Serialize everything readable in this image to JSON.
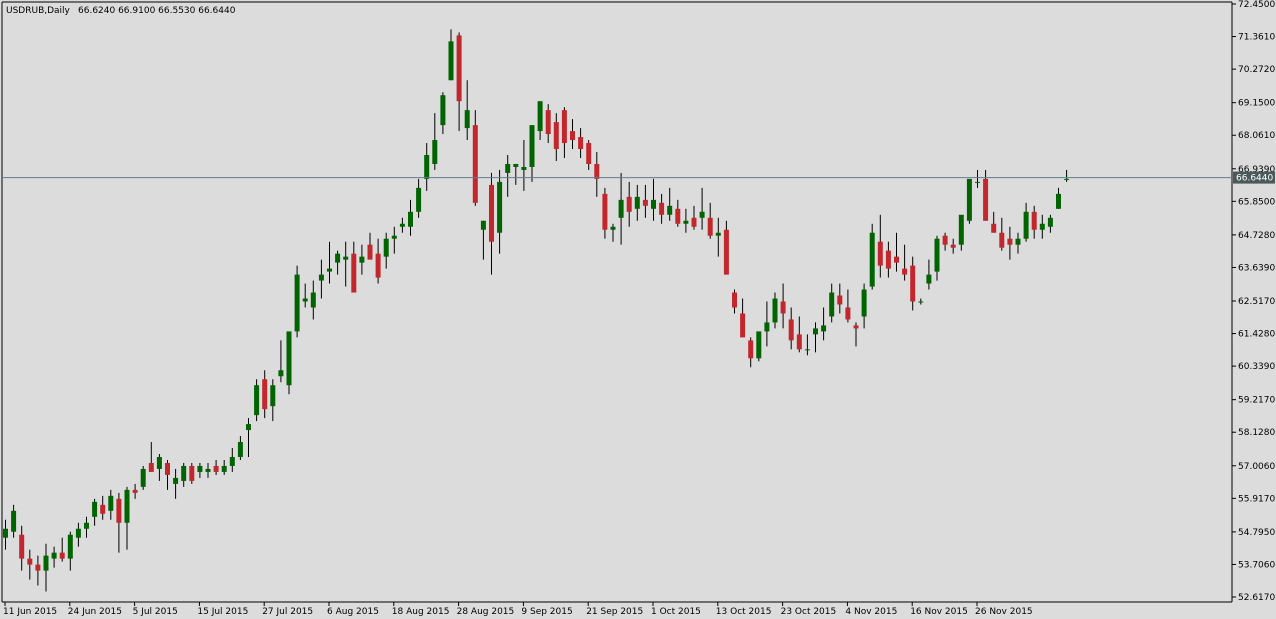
{
  "header": {
    "symbol_label": "USDRUB,Daily",
    "ohlc_label": "66.6240 66.9100 66.5530 66.6440"
  },
  "colors": {
    "background": "#dcdcdc",
    "bull": "#006400",
    "bear": "#c1272d",
    "wick": "#000000",
    "axis": "#000000",
    "price_line": "#5f7f8f",
    "price_label_bg": "#4a5a5a",
    "price_label_text": "#ffffff"
  },
  "chart_data": {
    "type": "candlestick",
    "title": "USDRUB,Daily",
    "grid": false,
    "ylim": [
      52.617,
      72.45
    ],
    "current_price": 66.644,
    "y_ticks": [
      "72.4500",
      "71.3610",
      "70.2720",
      "69.1500",
      "68.0610",
      "66.9390",
      "65.8500",
      "64.7280",
      "63.6390",
      "62.5170",
      "61.4280",
      "60.3390",
      "59.2170",
      "58.1280",
      "57.0060",
      "55.9170",
      "54.7950",
      "53.7060",
      "52.6170"
    ],
    "x_ticks": [
      "11 Jun 2015",
      "24 Jun 2015",
      "5 Jul 2015",
      "15 Jul 2015",
      "27 Jul 2015",
      "6 Aug 2015",
      "18 Aug 2015",
      "28 Aug 2015",
      "9 Sep 2015",
      "21 Sep 2015",
      "1 Oct 2015",
      "13 Oct 2015",
      "23 Oct 2015",
      "4 Nov 2015",
      "16 Nov 2015",
      "26 Nov 2015"
    ],
    "x_tick_index": [
      0,
      8,
      16,
      24,
      32,
      40,
      48,
      56,
      64,
      72,
      80,
      88,
      96,
      104,
      112,
      120
    ],
    "candles": [
      [
        54.6,
        55.2,
        54.2,
        54.9
      ],
      [
        54.8,
        55.7,
        54.6,
        55.5
      ],
      [
        54.7,
        55.0,
        53.5,
        53.9
      ],
      [
        53.9,
        54.2,
        53.2,
        53.7
      ],
      [
        53.7,
        54.0,
        53.0,
        53.5
      ],
      [
        53.5,
        54.4,
        52.8,
        54.0
      ],
      [
        53.9,
        54.3,
        53.6,
        54.1
      ],
      [
        54.1,
        54.6,
        53.8,
        53.9
      ],
      [
        53.9,
        54.8,
        53.5,
        54.7
      ],
      [
        54.6,
        55.1,
        54.3,
        54.9
      ],
      [
        54.9,
        55.3,
        54.6,
        55.1
      ],
      [
        55.3,
        55.9,
        55.0,
        55.8
      ],
      [
        55.7,
        56.0,
        55.2,
        55.4
      ],
      [
        55.5,
        56.2,
        55.2,
        56.0
      ],
      [
        55.9,
        56.1,
        54.1,
        55.1
      ],
      [
        55.1,
        56.3,
        54.2,
        56.2
      ],
      [
        56.2,
        56.4,
        55.9,
        56.1
      ],
      [
        56.3,
        57.0,
        56.2,
        56.9
      ],
      [
        57.1,
        57.8,
        56.9,
        56.8
      ],
      [
        56.9,
        57.4,
        56.5,
        57.3
      ],
      [
        57.1,
        57.2,
        56.2,
        56.7
      ],
      [
        56.4,
        56.9,
        55.9,
        56.6
      ],
      [
        56.5,
        57.1,
        56.3,
        57.0
      ],
      [
        57.0,
        57.1,
        56.4,
        56.5
      ],
      [
        56.8,
        57.1,
        56.6,
        57.0
      ],
      [
        56.8,
        57.1,
        56.6,
        56.9
      ],
      [
        57.0,
        57.2,
        56.7,
        56.8
      ],
      [
        56.8,
        57.2,
        56.7,
        57.0
      ],
      [
        57.0,
        57.6,
        56.8,
        57.3
      ],
      [
        57.3,
        58.0,
        57.2,
        57.8
      ],
      [
        58.2,
        58.6,
        57.3,
        58.4
      ],
      [
        58.7,
        59.9,
        58.5,
        59.7
      ],
      [
        59.9,
        60.2,
        58.6,
        58.9
      ],
      [
        59.0,
        59.9,
        58.5,
        59.7
      ],
      [
        60.0,
        61.2,
        59.8,
        60.2
      ],
      [
        59.7,
        60.9,
        59.4,
        61.5
      ],
      [
        61.5,
        63.7,
        61.3,
        63.4
      ],
      [
        62.5,
        63.1,
        62.3,
        62.6
      ],
      [
        62.3,
        63.2,
        61.9,
        62.8
      ],
      [
        63.2,
        63.9,
        62.6,
        63.4
      ],
      [
        63.5,
        64.5,
        63.1,
        63.6
      ],
      [
        63.8,
        64.2,
        63.4,
        64.1
      ],
      [
        63.9,
        64.5,
        63.0,
        64.0
      ],
      [
        64.1,
        64.5,
        62.9,
        62.8
      ],
      [
        63.8,
        64.4,
        63.4,
        64.0
      ],
      [
        64.4,
        64.8,
        64.0,
        63.9
      ],
      [
        64.1,
        64.6,
        63.1,
        63.3
      ],
      [
        64.0,
        64.8,
        63.6,
        64.6
      ],
      [
        64.6,
        65.0,
        64.1,
        64.7
      ],
      [
        65.0,
        65.3,
        64.8,
        65.1
      ],
      [
        65.0,
        65.9,
        64.7,
        65.5
      ],
      [
        65.5,
        66.6,
        65.3,
        66.3
      ],
      [
        66.6,
        67.8,
        66.2,
        67.4
      ],
      [
        67.1,
        68.8,
        66.9,
        67.9
      ],
      [
        68.4,
        69.5,
        68.1,
        69.4
      ],
      [
        69.9,
        71.6,
        69.9,
        71.2
      ],
      [
        71.4,
        71.5,
        68.2,
        69.2
      ],
      [
        68.3,
        69.9,
        67.9,
        68.9
      ],
      [
        68.4,
        68.9,
        65.7,
        65.8
      ],
      [
        64.9,
        65.2,
        63.9,
        65.2
      ],
      [
        66.4,
        66.8,
        63.4,
        64.5
      ],
      [
        64.8,
        66.9,
        64.1,
        66.5
      ],
      [
        66.8,
        67.4,
        66.0,
        67.1
      ],
      [
        67.0,
        67.1,
        66.4,
        67.1
      ],
      [
        66.9,
        67.9,
        66.2,
        67.0
      ],
      [
        67.0,
        68.0,
        66.5,
        68.4
      ],
      [
        68.2,
        68.9,
        67.9,
        69.2
      ],
      [
        68.9,
        69.1,
        67.8,
        68.1
      ],
      [
        68.5,
        68.8,
        67.2,
        67.6
      ],
      [
        68.9,
        69.0,
        67.3,
        67.8
      ],
      [
        68.2,
        68.6,
        67.6,
        67.9
      ],
      [
        68.0,
        68.3,
        67.3,
        67.6
      ],
      [
        67.8,
        67.9,
        66.9,
        67.1
      ],
      [
        67.1,
        67.5,
        66.0,
        66.6
      ],
      [
        66.1,
        66.3,
        64.6,
        64.9
      ],
      [
        64.9,
        65.1,
        64.5,
        65.0
      ],
      [
        65.3,
        66.8,
        64.4,
        65.9
      ],
      [
        66.0,
        66.5,
        65.0,
        65.5
      ],
      [
        65.6,
        66.4,
        65.2,
        66.0
      ],
      [
        65.9,
        66.4,
        65.3,
        65.7
      ],
      [
        65.6,
        66.6,
        65.2,
        65.9
      ],
      [
        65.8,
        66.1,
        65.1,
        65.4
      ],
      [
        65.4,
        66.3,
        65.2,
        65.7
      ],
      [
        65.6,
        65.9,
        65.0,
        65.1
      ],
      [
        65.1,
        65.6,
        64.8,
        65.2
      ],
      [
        65.3,
        65.7,
        64.9,
        65.0
      ],
      [
        65.3,
        66.3,
        64.9,
        65.5
      ],
      [
        65.3,
        65.8,
        64.6,
        64.7
      ],
      [
        64.7,
        65.3,
        64.0,
        64.8
      ],
      [
        64.9,
        65.2,
        63.4,
        63.4
      ],
      [
        62.8,
        62.9,
        62.1,
        62.3
      ],
      [
        62.1,
        62.6,
        61.5,
        61.3
      ],
      [
        61.2,
        61.3,
        60.3,
        60.6
      ],
      [
        60.6,
        61.4,
        60.5,
        61.5
      ],
      [
        61.5,
        62.5,
        61.0,
        61.8
      ],
      [
        61.8,
        62.8,
        61.6,
        62.6
      ],
      [
        62.5,
        63.1,
        61.6,
        62.1
      ],
      [
        61.9,
        62.3,
        60.9,
        61.2
      ],
      [
        61.4,
        62.0,
        60.8,
        60.9
      ],
      [
        60.9,
        61.4,
        60.7,
        60.9
      ],
      [
        61.4,
        61.8,
        60.8,
        61.6
      ],
      [
        61.5,
        62.3,
        61.2,
        61.7
      ],
      [
        62.0,
        63.1,
        61.8,
        62.8
      ],
      [
        62.7,
        63.1,
        62.1,
        62.4
      ],
      [
        62.3,
        62.9,
        61.8,
        61.9
      ],
      [
        61.7,
        61.8,
        61.0,
        61.6
      ],
      [
        62.0,
        63.1,
        61.6,
        62.9
      ],
      [
        63.0,
        65.1,
        62.9,
        64.8
      ],
      [
        64.5,
        65.4,
        63.3,
        63.7
      ],
      [
        64.2,
        64.5,
        63.3,
        63.6
      ],
      [
        64.0,
        64.8,
        63.5,
        63.8
      ],
      [
        63.6,
        64.4,
        63.2,
        63.4
      ],
      [
        63.7,
        64.0,
        62.2,
        62.5
      ],
      [
        62.5,
        62.6,
        62.4,
        62.5
      ],
      [
        63.1,
        63.9,
        62.9,
        63.4
      ],
      [
        63.5,
        64.7,
        63.2,
        64.6
      ],
      [
        64.7,
        64.8,
        64.2,
        64.4
      ],
      [
        64.4,
        64.6,
        64.1,
        64.3
      ],
      [
        64.4,
        65.2,
        64.2,
        65.4
      ],
      [
        65.2,
        66.6,
        65.1,
        66.6
      ],
      [
        66.5,
        66.9,
        66.3,
        66.5
      ],
      [
        66.6,
        66.9,
        65.2,
        65.2
      ],
      [
        65.1,
        65.5,
        64.8,
        64.8
      ],
      [
        64.8,
        65.3,
        64.2,
        64.3
      ],
      [
        64.6,
        65.0,
        63.9,
        64.4
      ],
      [
        64.4,
        64.8,
        64.1,
        64.6
      ],
      [
        64.6,
        65.8,
        64.5,
        65.5
      ],
      [
        65.5,
        65.7,
        64.6,
        64.9
      ],
      [
        64.9,
        65.4,
        64.6,
        65.1
      ],
      [
        65.0,
        65.4,
        64.8,
        65.3
      ],
      [
        65.6,
        66.3,
        65.6,
        66.1
      ],
      [
        66.6,
        66.9,
        66.5,
        66.6
      ]
    ]
  }
}
